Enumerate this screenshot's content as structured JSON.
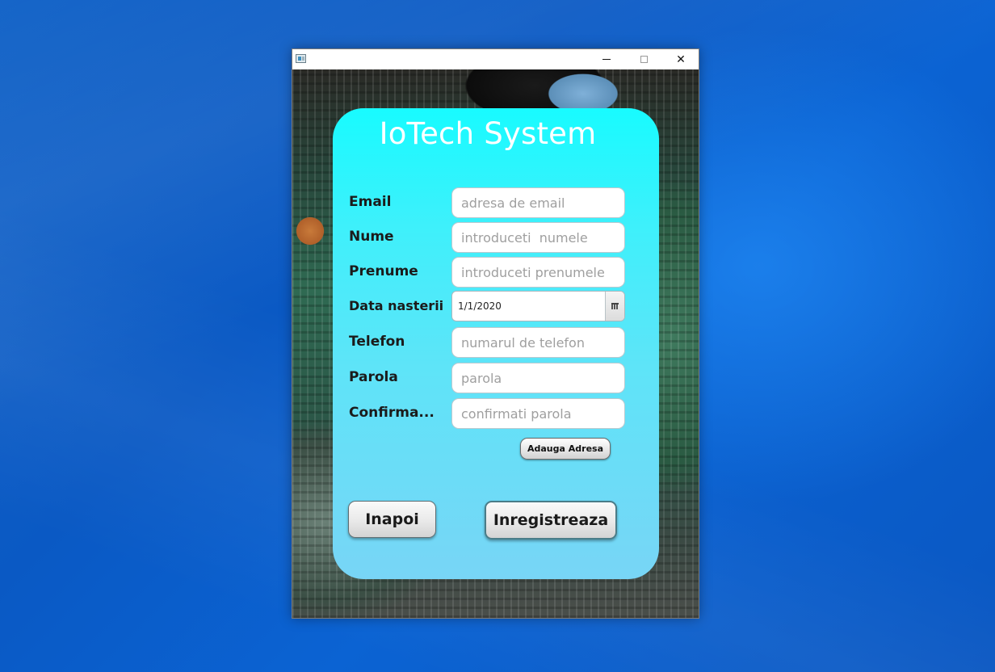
{
  "window": {
    "controls": {
      "minimize_icon": "minimize-icon",
      "maximize_icon": "maximize-icon",
      "close_glyph": "✕"
    }
  },
  "form": {
    "title": "IoTech System",
    "fields": [
      {
        "label": "Email",
        "placeholder": "adresa de email",
        "value": ""
      },
      {
        "label": "Nume",
        "placeholder": "introduceti  numele",
        "value": ""
      },
      {
        "label": "Prenume",
        "placeholder": "introduceti prenumele",
        "value": ""
      },
      {
        "label": "Data nasterii",
        "value": "1/1/2020"
      },
      {
        "label": "Telefon",
        "placeholder": "numarul de telefon",
        "value": ""
      },
      {
        "label": "Parola",
        "placeholder": "parola",
        "value": ""
      },
      {
        "label": "Confirma...",
        "placeholder": "confirmati parola",
        "value": ""
      }
    ],
    "add_address_label": "Adauga Adresa",
    "back_label": "Inapoi",
    "register_label": "Inregistreaza"
  },
  "colors": {
    "card_top": "#18fbff",
    "card_bottom": "#78d5f6",
    "title_text": "#ffffff",
    "desktop_blue": "#0a59c4"
  }
}
